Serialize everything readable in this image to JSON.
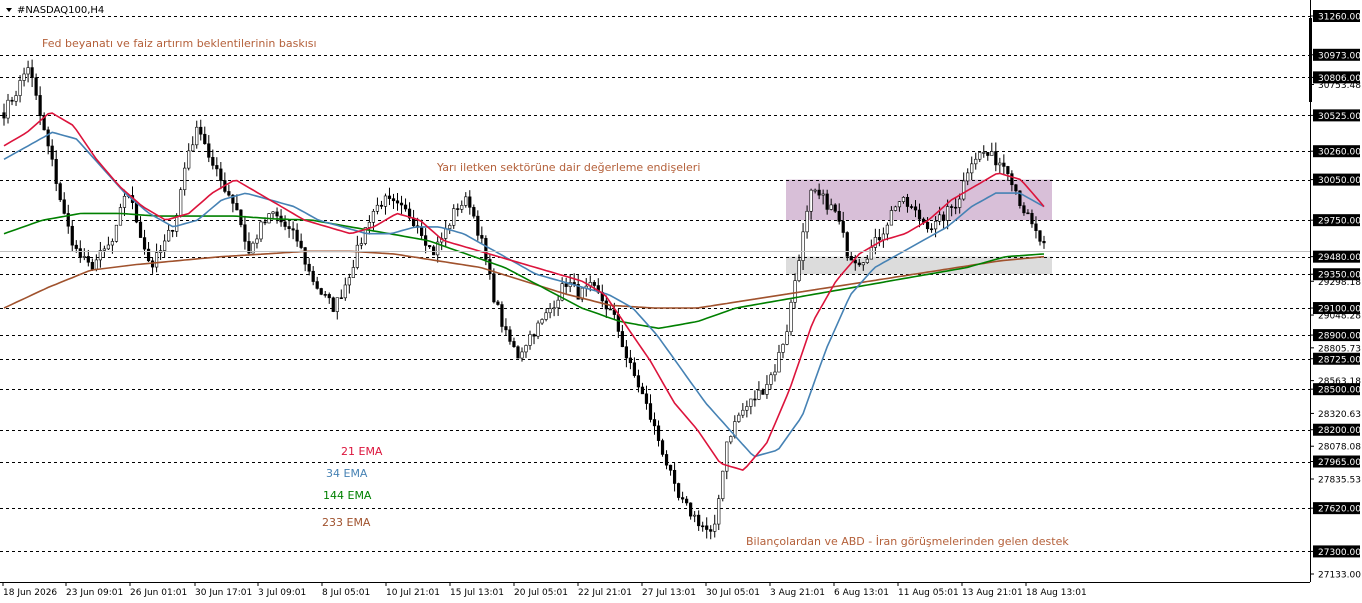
{
  "chart_data": {
    "type": "candlestick",
    "title": "#NASDAQ100,H4",
    "ylim": [
      27133,
      31260
    ],
    "y_ticks": [
      31260.0,
      30973.0,
      30806.0,
      30753.48,
      30525.0,
      30260.0,
      30050.0,
      29750.0,
      29480.0,
      29350.0,
      29298.18,
      29100.0,
      29048.28,
      28900.0,
      28805.73,
      28725.0,
      28563.18,
      28500.0,
      28320.63,
      28200.0,
      28078.08,
      27965.0,
      27835.53,
      27620.0,
      27300.0,
      27133.0
    ],
    "y_tick_labels": [
      "31260.00",
      "30973.00",
      "30806.00",
      "30753.48",
      "30525.00",
      "30260.00",
      "30050.00",
      "29750.00",
      "29480.00",
      "29350.00",
      "29298.18",
      "29100.00",
      "29048.28",
      "28900.00",
      "28805.73",
      "28725.00",
      "28563.18",
      "28500.00",
      "28320.63",
      "28200.00",
      "28078.08",
      "27965.00",
      "27835.53",
      "27620.00",
      "27300.00",
      "27133.00"
    ],
    "levels": [
      31260,
      30973,
      30806,
      30525,
      30260,
      30050,
      29750,
      29480,
      29350,
      29100,
      28900,
      28725,
      28500,
      28200,
      27965,
      27620,
      27300
    ],
    "current_price": 29523,
    "x_tick_labels": [
      "18 Jun 2026",
      "23 Jun 09:01",
      "26 Jun 01:01",
      "30 Jun 17:01",
      "3 Jul 09:01",
      "8 Jul 05:01",
      "10 Jul 21:01",
      "15 Jul 13:01",
      "20 Jul 05:01",
      "22 Jul 21:01",
      "27 Jul 13:01",
      "30 Jul 05:01",
      "3 Aug 21:01",
      "6 Aug 13:01",
      "11 Aug 05:01",
      "13 Aug 21:01",
      "18 Aug 13:01"
    ],
    "annotations": [
      "Fed beyanatı ve faiz artırım beklentilerinin baskısı",
      "Yarı iletken sektörüne dair değerleme endişeleri",
      "Bilançolardan ve ABD - İran görüşmelerinden gelen destek"
    ],
    "indicators": [
      {
        "name": "21 EMA",
        "color": "#dc143c"
      },
      {
        "name": "34 EMA",
        "color": "#4682b4"
      },
      {
        "name": "144 EMA",
        "color": "#008000"
      },
      {
        "name": "233 EMA",
        "color": "#a0522d"
      }
    ],
    "zones": [
      {
        "from": 29750,
        "to": 30050,
        "color": "#d8bfd8"
      },
      {
        "from": 29350,
        "to": 29480,
        "color": "#dcdcdc"
      }
    ],
    "close_anchors": [
      30550,
      30700,
      30900,
      30500,
      30150,
      29750,
      29500,
      29400,
      29500,
      29600,
      30000,
      29700,
      29400,
      29550,
      29750,
      30250,
      30450,
      30150,
      30000,
      29850,
      29500,
      29700,
      29800,
      29700,
      29600,
      29350,
      29200,
      29100,
      29300,
      29550,
      29800,
      29900,
      29850,
      29800,
      29700,
      29500,
      29650,
      29850,
      29900,
      29600,
      29200,
      28900,
      28750,
      28900,
      29000,
      29150,
      29300,
      29200,
      29250,
      29150,
      29000,
      28700,
      28500,
      28250,
      28000,
      27700,
      27600,
      27500,
      27400,
      28100,
      28300,
      28400,
      28500,
      28650,
      28950,
      29500,
      29950,
      29900,
      29800,
      29500,
      29450,
      29550,
      29700,
      29900,
      29850,
      29750,
      29700,
      29800,
      29900,
      30200,
      30250,
      30200,
      30150,
      29900,
      29700,
      29550
    ],
    "ema_21_anchors": [
      30300,
      30400,
      30550,
      30450,
      30200,
      30000,
      29850,
      29750,
      29800,
      29950,
      30050,
      29950,
      29850,
      29750,
      29700,
      29650,
      29700,
      29800,
      29750,
      29600,
      29550,
      29500,
      29450,
      29400,
      29350,
      29300,
      29200,
      28950,
      28700,
      28400,
      28200,
      27950,
      27900,
      28100,
      28500,
      29000,
      29300,
      29500,
      29600,
      29650,
      29750,
      29900,
      30000,
      30100,
      30050,
      29850
    ],
    "ema_34_anchors": [
      30200,
      30300,
      30400,
      30350,
      30150,
      29950,
      29800,
      29700,
      29750,
      29900,
      29950,
      29900,
      29850,
      29750,
      29700,
      29650,
      29650,
      29700,
      29700,
      29650,
      29550,
      29450,
      29350,
      29300,
      29250,
      29200,
      29100,
      28900,
      28650,
      28400,
      28200,
      28000,
      28050,
      28300,
      28800,
      29200,
      29400,
      29500,
      29600,
      29700,
      29850,
      29950,
      29950,
      29850
    ],
    "ema_144_anchors": [
      29650,
      29750,
      29800,
      29800,
      29780,
      29780,
      29780,
      29760,
      29750,
      29700,
      29650,
      29600,
      29500,
      29400,
      29250,
      29100,
      29000,
      28950,
      29000,
      29100,
      29150,
      29200,
      29250,
      29300,
      29350,
      29400,
      29480,
      29500
    ],
    "ema_233_anchors": [
      29100,
      29250,
      29380,
      29420,
      29450,
      29480,
      29500,
      29520,
      29520,
      29500,
      29450,
      29400,
      29300,
      29200,
      29120,
      29100,
      29100,
      29150,
      29200,
      29250,
      29300,
      29350,
      29400,
      29450,
      29480
    ]
  }
}
